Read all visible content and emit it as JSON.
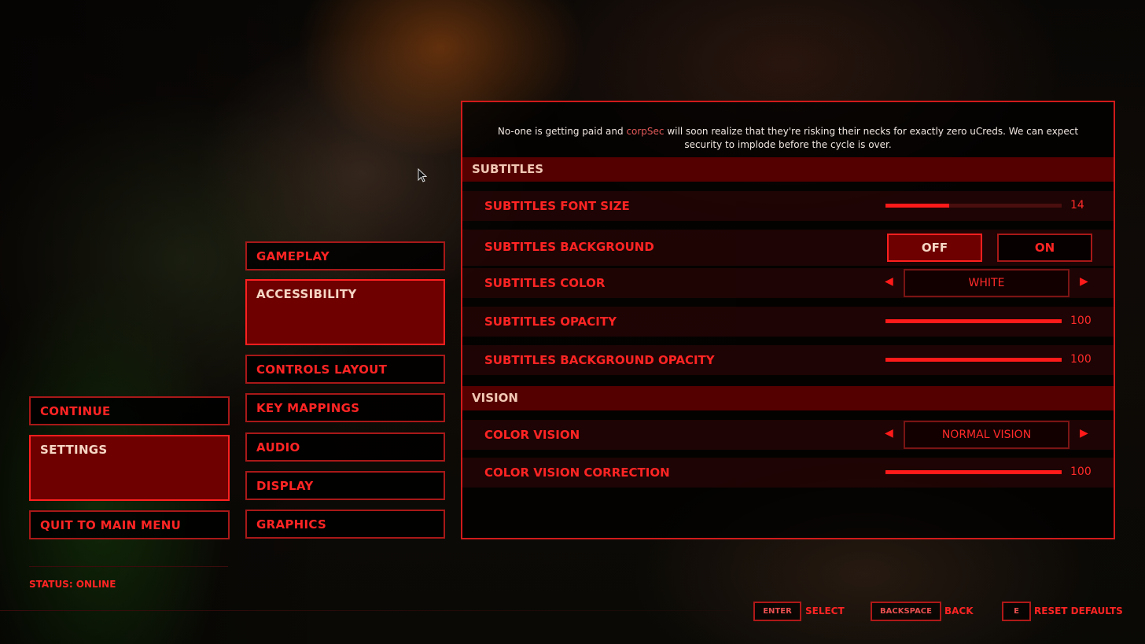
{
  "main_menu": {
    "items": [
      {
        "label": "CONTINUE",
        "active": false
      },
      {
        "label": "SETTINGS",
        "active": true
      },
      {
        "label": "QUIT TO MAIN MENU",
        "active": false
      }
    ],
    "status": "STATUS: ONLINE"
  },
  "settings_tabs": [
    {
      "label": "GAMEPLAY",
      "active": false
    },
    {
      "label": "ACCESSIBILITY",
      "active": true
    },
    {
      "label": "CONTROLS LAYOUT",
      "active": false
    },
    {
      "label": "KEY MAPPINGS",
      "active": false
    },
    {
      "label": "AUDIO",
      "active": false
    },
    {
      "label": "DISPLAY",
      "active": false
    },
    {
      "label": "GRAPHICS",
      "active": false
    }
  ],
  "preview": {
    "before": "No-one is getting paid and ",
    "highlight": "corpSec",
    "after": " will soon realize that they're risking their necks for exactly zero uCreds. We can expect security to implode before the cycle is over."
  },
  "sections": {
    "subtitles": {
      "title": "SUBTITLES",
      "font_size": {
        "label": "SUBTITLES FONT SIZE",
        "value": "14",
        "fill_fraction": 0.36
      },
      "background": {
        "label": "SUBTITLES BACKGROUND",
        "options": [
          "OFF",
          "ON"
        ],
        "selected": "OFF"
      },
      "color": {
        "label": "SUBTITLES COLOR",
        "value": "WHITE"
      },
      "opacity": {
        "label": "SUBTITLES OPACITY",
        "value": "100",
        "fill_fraction": 1.0
      },
      "bg_opacity": {
        "label": "SUBTITLES BACKGROUND OPACITY",
        "value": "100",
        "fill_fraction": 1.0
      }
    },
    "vision": {
      "title": "VISION",
      "color_vision": {
        "label": "COLOR VISION",
        "value": "NORMAL VISION"
      },
      "correction": {
        "label": "COLOR VISION CORRECTION",
        "value": "100",
        "fill_fraction": 1.0
      }
    }
  },
  "icons": {
    "arrow_left": "◀",
    "arrow_right": "▶"
  },
  "footer": {
    "hints": [
      {
        "key": "ENTER",
        "action": "SELECT"
      },
      {
        "key": "BACKSPACE",
        "action": "BACK"
      },
      {
        "key": "E",
        "action": "RESET DEFAULTS"
      }
    ]
  },
  "colors": {
    "accent": "#ff2424",
    "active_fill": "#6e0000",
    "section_fill": "#540000"
  }
}
